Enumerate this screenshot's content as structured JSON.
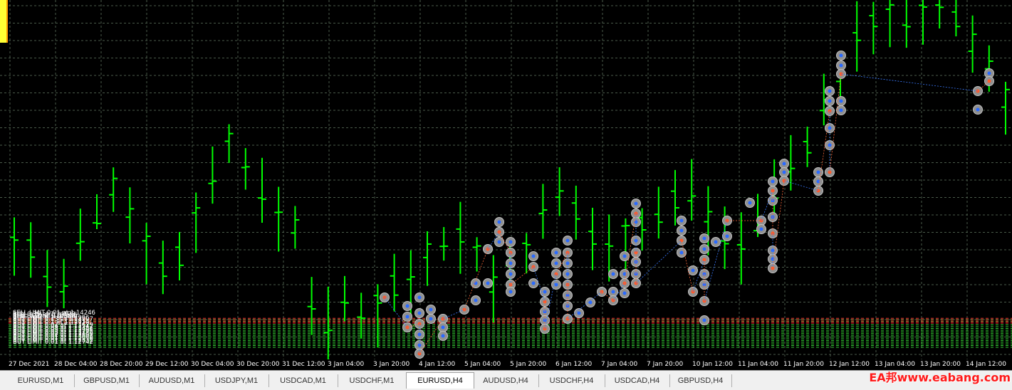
{
  "chart": {
    "symbol": "EURUSD,H4",
    "colors": {
      "background": "#000000",
      "grid": "#4a5a4a",
      "candle": "#00ff00",
      "sell_line": "#ff3030",
      "buy_line": "#33cc33"
    },
    "order_labels": [
      {
        "text": "SELL LIMIT 0.01 at 1.14246",
        "p": 1.14246,
        "kind": "sell"
      },
      {
        "text": "BUY 0.35 at 1.14173",
        "p": 1.14173,
        "kind": "buy"
      },
      {
        "text": "SELL 0.01 at 1.14155",
        "p": 1.14155,
        "kind": "sell"
      },
      {
        "text": "BUY 0.21 at 1.14084",
        "p": 1.14084,
        "kind": "buy"
      },
      {
        "text": "SELL 0.02 at 1.14066",
        "p": 1.14066,
        "kind": "sell"
      },
      {
        "text": "BUY LIMIT 0.2 at 1.13996",
        "p": 1.13996,
        "kind": "sell"
      },
      {
        "text": "BUY LIMIT 0.13 at 1.13907",
        "p": 1.13907,
        "kind": "buy"
      },
      {
        "text": "BUY LIMIT 0.1 at 1.13811",
        "p": 1.13811,
        "kind": "buy"
      },
      {
        "text": "BUY LIMIT 0.1 at 1.13720",
        "p": 1.1372,
        "kind": "buy"
      },
      {
        "text": "BUY LIMIT 0.07 at 1.13629",
        "p": 1.13629,
        "kind": "buy"
      },
      {
        "text": "BUY LIMIT 0.06 at 1.13542",
        "p": 1.13542,
        "kind": "buy"
      },
      {
        "text": "BUY LIMIT 0.04 at 1.13454",
        "p": 1.13454,
        "kind": "buy"
      },
      {
        "text": "BUY LIMIT 0.03 at 1.13364",
        "p": 1.13364,
        "kind": "buy"
      },
      {
        "text": "BUY LIMIT 0.03 at 1.13275",
        "p": 1.13275,
        "kind": "buy"
      },
      {
        "text": "BUY LIMIT 0.02 at 1.13186",
        "p": 1.13186,
        "kind": "buy"
      },
      {
        "text": "BUY LIMIT 0.02 at 1.13097",
        "p": 1.13097,
        "kind": "buy"
      },
      {
        "text": "BUY LIMIT 0.01 at 1.13008",
        "p": 1.13008,
        "kind": "buy"
      },
      {
        "text": "BUY LIMIT 0.01 at 1.12918",
        "p": 1.12918,
        "kind": "buy"
      },
      {
        "text": "BUY LIMIT 0.01 at 1.12832",
        "p": 1.12832,
        "kind": "buy"
      },
      {
        "text": "BUY LIMIT 0.01 at 1.12742",
        "p": 1.12742,
        "kind": "buy"
      }
    ],
    "x_ticks": [
      "27 Dec 2021",
      "28 Dec 04:00",
      "28 Dec 20:00",
      "29 Dec 12:00",
      "30 Dec 04:00",
      "30 Dec 20:00",
      "31 Dec 12:00",
      "3 Jan 04:00",
      "3 Jan 20:00",
      "4 Jan 12:00",
      "5 Jan 04:00",
      "5 Jan 20:00",
      "6 Jan 12:00",
      "7 Jan 04:00",
      "7 Jan 20:00",
      "10 Jan 12:00",
      "11 Jan 04:00",
      "11 Jan 20:00",
      "12 Jan 12:00",
      "13 Jan 04:00",
      "13 Jan 20:00",
      "14 Jan 12:00"
    ]
  },
  "tabs": [
    {
      "label": "EURUSD,M1"
    },
    {
      "label": "GBPUSD,M1"
    },
    {
      "label": "AUDUSD,M1"
    },
    {
      "label": "USDJPY,M1"
    },
    {
      "label": "USDCAD,M1"
    },
    {
      "label": "USDCHF,M1"
    },
    {
      "label": "EURUSD,H4",
      "active": true
    },
    {
      "label": "AUDUSD,H4"
    },
    {
      "label": "USDCHF,H4"
    },
    {
      "label": "USDCAD,H4"
    },
    {
      "label": "GBPUSD,H4"
    }
  ],
  "watermark": "EA邦www.eabang.com"
}
